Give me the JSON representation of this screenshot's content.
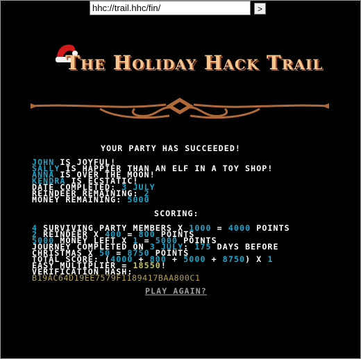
{
  "browser": {
    "url": "hhc://trail.hhc/fin/",
    "go_label": ">"
  },
  "title": "The Holiday Hack Trail",
  "status": {
    "headline": "YOUR PARTY HAS SUCCEEDED!"
  },
  "party": [
    {
      "name": "JOHN",
      "mood": " IS JOYFUL!"
    },
    {
      "name": "SALLY",
      "mood": " IS HAPPIER THAN AN ELF IN A TOY SHOP!"
    },
    {
      "name": "ANNA",
      "mood": " IS OVER THE MOON!"
    },
    {
      "name": "KENDRA",
      "mood": " IS ECSTATIC!"
    }
  ],
  "summary": {
    "date_label": "DATE COMPLETED: ",
    "date_value": "3 JULY",
    "reindeer_label": "REINDEER REMAINING: ",
    "reindeer_value": "2",
    "money_label": "MONEY REMAINING: ",
    "money_value": "5000"
  },
  "scoring": {
    "heading": "SCORING:",
    "party_count": "4",
    "party_text": " SURVIVING PARTY MEMBERS X ",
    "party_mult": "1000",
    "party_eq": " = ",
    "party_points": "4000",
    "party_tail": " POINTS",
    "reindeer_count": "2",
    "reindeer_text": " REINDEER X ",
    "reindeer_mult": "400",
    "reindeer_eq": " = ",
    "reindeer_points": "800",
    "reindeer_tail": " POINTS",
    "money_amount": "5000",
    "money_text": " MONEY LEFT X ",
    "money_mult": "1",
    "money_eq": " = ",
    "money_points": "5000",
    "money_tail": " POINTS",
    "journey_text": "JOURNEY COMPLETED ON ",
    "journey_date": "3 JULY",
    "journey_colon": ": ",
    "journey_days": "175",
    "journey_tail": " DAYS BEFORE",
    "christmas_text": "CHRISTMAS X ",
    "christmas_mult": "50",
    "christmas_eq": " = ",
    "christmas_points": "8750",
    "christmas_tail": " POINTS",
    "total_label": "TOTAL SCORE: (",
    "total_a": "4000",
    "plus1": " + ",
    "total_b": "800",
    "plus2": " + ",
    "total_c": "5000",
    "plus3": " + ",
    "total_d": "8750",
    "total_x": ") X ",
    "total_mult": "1",
    "easy_label": "EASY MULTIPLIER = ",
    "easy_value": "18550",
    "easy_tail": "!",
    "hash_label": "VERIFICATION HASH:",
    "hash_value": "B19AC64D19EE7579F1189417BAA800C1"
  },
  "play_again": "PLAY AGAIN?"
}
